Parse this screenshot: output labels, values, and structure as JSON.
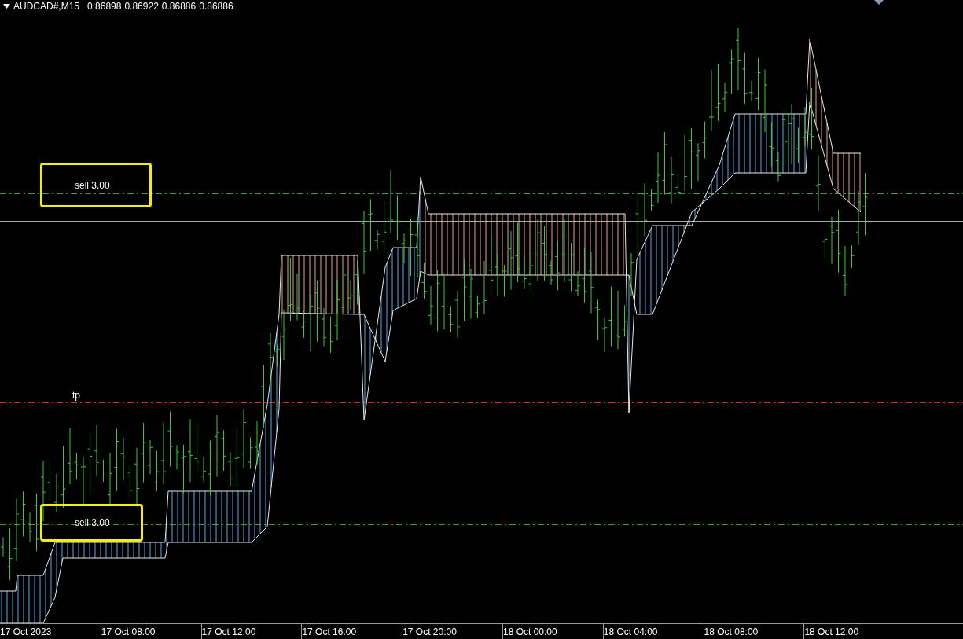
{
  "header": {
    "symbol": "AUDCAD#,M15",
    "quotes": [
      "0.86898",
      "0.86922",
      "0.86886",
      "0.86886"
    ]
  },
  "levels": [
    {
      "kind": "order",
      "color": "#3f9a3f",
      "label": "sell 3.00"
    },
    {
      "kind": "bid",
      "color": "#a8a8a8"
    },
    {
      "kind": "tp",
      "color": "#c83030",
      "label": "tp"
    },
    {
      "kind": "order",
      "color": "#3f9a3f",
      "label": "sell 3.00"
    }
  ],
  "time_axis": [
    "17 Oct 2023",
    "17 Oct 08:00",
    "17 Oct 12:00",
    "17 Oct 16:00",
    "17 Oct 20:00",
    "18 Oct 00:00",
    "18 Oct 04:00",
    "18 Oct 08:00",
    "18 Oct 12:00"
  ]
}
